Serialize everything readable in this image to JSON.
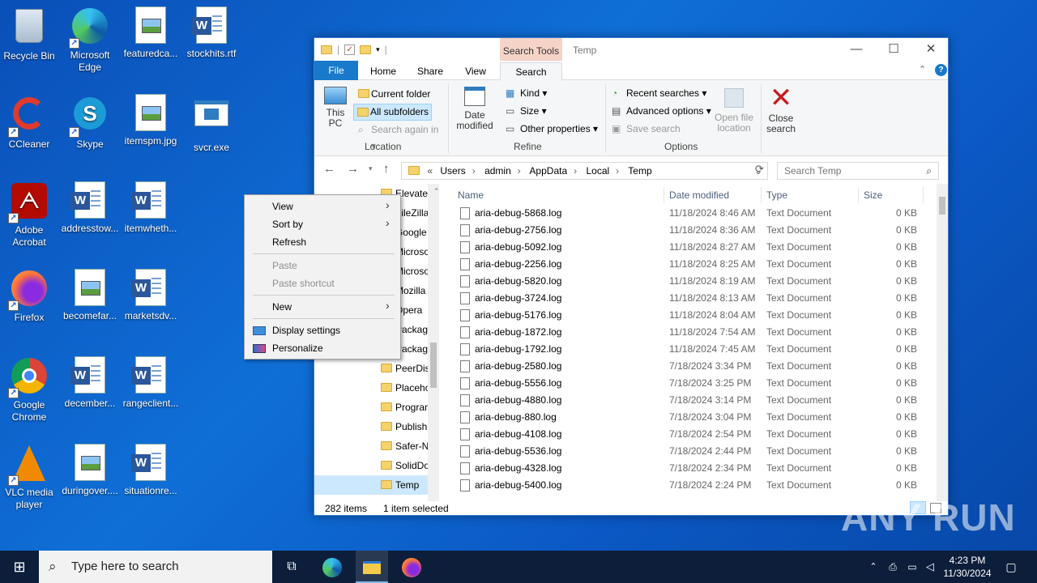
{
  "desktop": {
    "icons": [
      {
        "label": "Recycle Bin"
      },
      {
        "label": "Microsoft Edge"
      },
      {
        "label": "featuredca..."
      },
      {
        "label": "stockhits.rtf"
      },
      {
        "label": "CCleaner"
      },
      {
        "label": "Skype"
      },
      {
        "label": "itemspm.jpg"
      },
      {
        "label": "svcr.exe"
      },
      {
        "label": "Adobe Acrobat"
      },
      {
        "label": "addresstow..."
      },
      {
        "label": "itemwheth..."
      },
      {
        "label": "Firefox"
      },
      {
        "label": "becomefar..."
      },
      {
        "label": "marketsdv..."
      },
      {
        "label": "Google Chrome"
      },
      {
        "label": "december..."
      },
      {
        "label": "rangeclient..."
      },
      {
        "label": "VLC media player"
      },
      {
        "label": "duringover...."
      },
      {
        "label": "situationre..."
      }
    ]
  },
  "explorer": {
    "title": "Temp",
    "search_tools": "Search Tools",
    "tabs": [
      "File",
      "Home",
      "Share",
      "View",
      "Search"
    ],
    "ribbon": {
      "this_pc": "This PC",
      "current_folder": "Current folder",
      "all_subfolders": "All subfolders",
      "search_again": "Search again in",
      "location": "Location",
      "date_modified": "Date modified",
      "kind": "Kind",
      "size": "Size",
      "other_properties": "Other properties",
      "refine": "Refine",
      "recent_searches": "Recent searches",
      "advanced_options": "Advanced options",
      "save_search": "Save search",
      "options": "Options",
      "open_file_location": "Open file location",
      "close_search": "Close search"
    },
    "address": {
      "parts": [
        "Users",
        "admin",
        "AppData",
        "Local",
        "Temp"
      ],
      "search_placeholder": "Search Temp"
    },
    "nav_items": [
      "Elevate",
      "FileZilla",
      "Google",
      "Microsoft",
      "Microsoft",
      "Mozilla",
      "Opera",
      "Package",
      "Package",
      "PeerDist",
      "Placeho",
      "Program",
      "Publish",
      "Safer-N",
      "SolidDo",
      "Temp"
    ],
    "columns": [
      "Name",
      "Date modified",
      "Type",
      "Size"
    ],
    "files": [
      {
        "name": "aria-debug-5868.log",
        "date": "11/18/2024 8:46 AM",
        "type": "Text Document",
        "size": "0 KB"
      },
      {
        "name": "aria-debug-2756.log",
        "date": "11/18/2024 8:36 AM",
        "type": "Text Document",
        "size": "0 KB"
      },
      {
        "name": "aria-debug-5092.log",
        "date": "11/18/2024 8:27 AM",
        "type": "Text Document",
        "size": "0 KB"
      },
      {
        "name": "aria-debug-2256.log",
        "date": "11/18/2024 8:25 AM",
        "type": "Text Document",
        "size": "0 KB"
      },
      {
        "name": "aria-debug-5820.log",
        "date": "11/18/2024 8:19 AM",
        "type": "Text Document",
        "size": "0 KB"
      },
      {
        "name": "aria-debug-3724.log",
        "date": "11/18/2024 8:13 AM",
        "type": "Text Document",
        "size": "0 KB"
      },
      {
        "name": "aria-debug-5176.log",
        "date": "11/18/2024 8:04 AM",
        "type": "Text Document",
        "size": "0 KB"
      },
      {
        "name": "aria-debug-1872.log",
        "date": "11/18/2024 7:54 AM",
        "type": "Text Document",
        "size": "0 KB"
      },
      {
        "name": "aria-debug-1792.log",
        "date": "11/18/2024 7:45 AM",
        "type": "Text Document",
        "size": "0 KB"
      },
      {
        "name": "aria-debug-2580.log",
        "date": "7/18/2024 3:34 PM",
        "type": "Text Document",
        "size": "0 KB"
      },
      {
        "name": "aria-debug-5556.log",
        "date": "7/18/2024 3:25 PM",
        "type": "Text Document",
        "size": "0 KB"
      },
      {
        "name": "aria-debug-4880.log",
        "date": "7/18/2024 3:14 PM",
        "type": "Text Document",
        "size": "0 KB"
      },
      {
        "name": "aria-debug-880.log",
        "date": "7/18/2024 3:04 PM",
        "type": "Text Document",
        "size": "0 KB"
      },
      {
        "name": "aria-debug-4108.log",
        "date": "7/18/2024 2:54 PM",
        "type": "Text Document",
        "size": "0 KB"
      },
      {
        "name": "aria-debug-5536.log",
        "date": "7/18/2024 2:44 PM",
        "type": "Text Document",
        "size": "0 KB"
      },
      {
        "name": "aria-debug-4328.log",
        "date": "7/18/2024 2:34 PM",
        "type": "Text Document",
        "size": "0 KB"
      },
      {
        "name": "aria-debug-5400.log",
        "date": "7/18/2024 2:24 PM",
        "type": "Text Document",
        "size": "0 KB"
      }
    ],
    "status": {
      "items": "282 items",
      "selected": "1 item selected"
    }
  },
  "context_menu": {
    "view": "View",
    "sort_by": "Sort by",
    "refresh": "Refresh",
    "paste": "Paste",
    "paste_shortcut": "Paste shortcut",
    "new": "New",
    "display_settings": "Display settings",
    "personalize": "Personalize"
  },
  "taskbar": {
    "search_placeholder": "Type here to search",
    "time": "4:23 PM",
    "date": "11/30/2024"
  },
  "watermark": "ANY RUN"
}
